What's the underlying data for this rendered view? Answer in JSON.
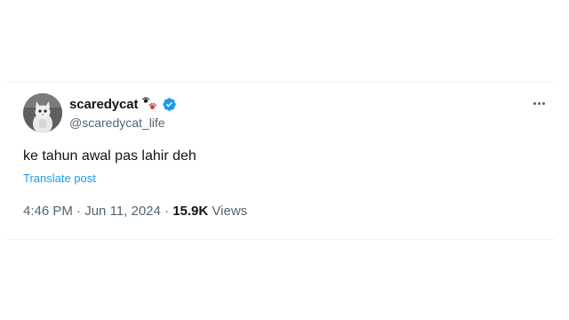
{
  "tweet": {
    "author": {
      "display_name": "scaredycat",
      "handle": "@scaredycat_life",
      "emoji_icon": "paw-prints-icon",
      "badge_icon": "verified-badge-icon",
      "avatar_icon": "cat-avatar"
    },
    "text": "ke tahun awal pas lahir deh",
    "translate_label": "Translate post",
    "time": "4:46 PM",
    "separator": "·",
    "date": "Jun 11, 2024",
    "views_count": "15.9K",
    "views_label": "Views",
    "more_icon": "more-options-icon"
  },
  "colors": {
    "primary_text": "#0f1419",
    "secondary_text": "#536471",
    "link": "#1d9bf0",
    "verified": "#1d9bf0"
  }
}
